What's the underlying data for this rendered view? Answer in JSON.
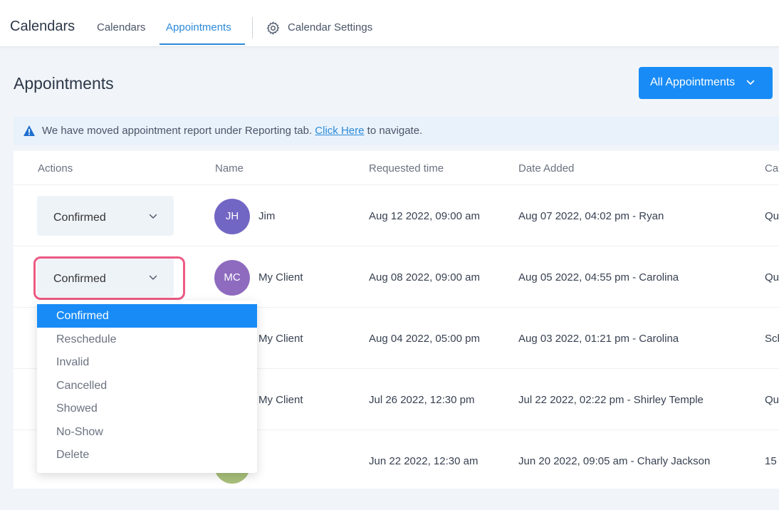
{
  "header": {
    "brand": "Calendars",
    "tabs": [
      {
        "label": "Calendars"
      },
      {
        "label": "Appointments"
      },
      {
        "label": "Calendar Settings",
        "icon": "gear-icon"
      }
    ],
    "active_tab": "Appointments"
  },
  "page": {
    "title": "Appointments",
    "filter_button": {
      "label": "All Appointments",
      "icon": "chevron-down-icon"
    }
  },
  "notice": {
    "icon": "warning-icon",
    "text_before": "We have moved appointment report under Reporting tab.",
    "link_text": "Click Here",
    "text_after": "to navigate."
  },
  "table": {
    "columns": [
      "Actions",
      "Name",
      "Requested time",
      "Date Added",
      "Cal"
    ],
    "rows": [
      {
        "status": "Confirmed",
        "initials": "JH",
        "avatar_color": "#7266c4",
        "name": "Jim",
        "requested": "Aug 12 2022, 09:00 am",
        "added": "Aug 07 2022, 04:02 pm - Ryan",
        "calendar": "Qu"
      },
      {
        "status": "Confirmed",
        "initials": "MC",
        "avatar_color": "#8e6bbf",
        "name": "My Client",
        "requested": "Aug 08 2022, 09:00 am",
        "added": "Aug 05 2022, 04:55 pm - Carolina",
        "calendar": "Qu"
      },
      {
        "status": "",
        "initials": "",
        "avatar_color": "",
        "name": "My Client",
        "requested": "Aug 04 2022, 05:00 pm",
        "added": "Aug 03 2022, 01:21 pm - Carolina",
        "calendar": "Sch"
      },
      {
        "status": "",
        "initials": "",
        "avatar_color": "",
        "name": "My Client",
        "requested": "Jul 26 2022, 12:30 pm",
        "added": "Jul 22 2022, 02:22 pm - Shirley Temple",
        "calendar": "Qu"
      },
      {
        "status": "",
        "initials": "",
        "avatar_color": "#a8c07a",
        "name": "",
        "requested": "Jun 22 2022, 12:30 am",
        "added": "Jun 20 2022, 09:05 am - Charly Jackson",
        "calendar": "15"
      }
    ]
  },
  "status_dropdown": {
    "options": [
      "Confirmed",
      "Reschedule",
      "Invalid",
      "Cancelled",
      "Showed",
      "No-Show",
      "Delete"
    ],
    "selected": "Confirmed"
  },
  "colors": {
    "accent": "#188bf6",
    "highlight": "#ec5a84"
  }
}
